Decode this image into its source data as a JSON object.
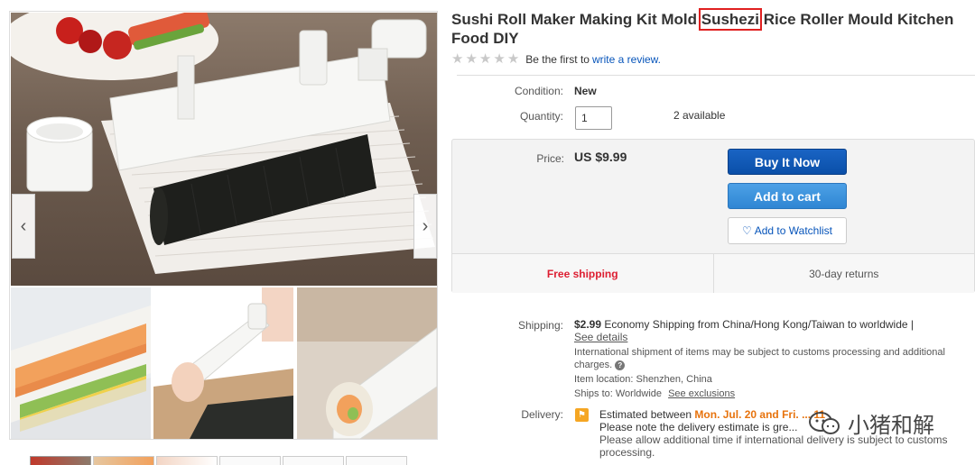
{
  "product": {
    "title_before": "Sushi Roll Maker Making Kit Mold ",
    "title_highlight": "Sushezi",
    "title_after": " Rice Roller Mould Kitchen Food DIY"
  },
  "rating": {
    "stars": 5,
    "filled": 0,
    "prompt": "Be the first to",
    "link": "write a review."
  },
  "details": {
    "condition_label": "Condition:",
    "condition_value": "New",
    "quantity_label": "Quantity:",
    "quantity_value": "1",
    "available": "2 available"
  },
  "buy_box": {
    "price_label": "Price:",
    "price": "US $9.99",
    "buy_now": "Buy It Now",
    "add_to_cart": "Add to cart",
    "watchlist": "Add to Watchlist",
    "free_shipping": "Free shipping",
    "returns": "30-day returns"
  },
  "shipping": {
    "label": "Shipping:",
    "cost": "$2.99",
    "method": "Economy Shipping from China/Hong Kong/Taiwan to worldwide |",
    "see_details": "See details",
    "customs_note": "International shipment of items may be subject to customs processing and additional charges.",
    "location_label": "Item location:",
    "location": "Shenzhen, China",
    "ships_to_label": "Ships to:",
    "ships_to": "Worldwide",
    "see_exclusions": "See exclusions"
  },
  "delivery": {
    "label": "Delivery:",
    "estimated_prefix": "Estimated between",
    "dates": "Mon. Jul. 20 and Fri. ... 11",
    "note_1": "Please note the delivery estimate is gre...",
    "note_2": "Please allow additional time if international delivery is subject to customs processing."
  },
  "watermark": {
    "text": "小猪和解"
  },
  "gallery": {
    "prev_arrow": "‹",
    "next_arrow": "›",
    "thumbnails": 7
  },
  "colors": {
    "link": "#0654ba",
    "buy_now": "#0a4fa8",
    "add_to_cart": "#2f86d3",
    "free_shipping": "#dd1e31",
    "delivery_dates": "#e7730d",
    "highlight_box": "#e02020"
  },
  "icons": {
    "heart": "heart-icon",
    "help": "help-icon",
    "delivery": "delivery-flag-icon",
    "prev": "chevron-left-icon",
    "next": "chevron-right-icon"
  }
}
